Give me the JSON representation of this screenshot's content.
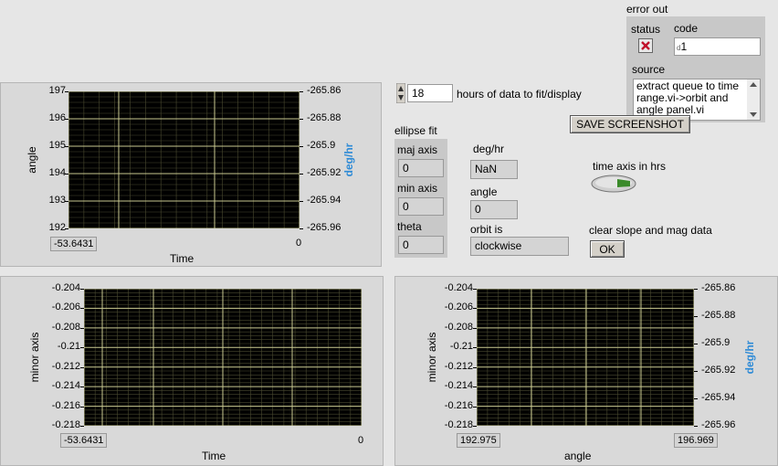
{
  "error_out": {
    "title": "error out",
    "status_label": "status",
    "code_label": "code",
    "code_value": "1",
    "code_prefix": "d",
    "source_label": "source",
    "source_text": "extract queue to time range.vi->orbit and angle panel.vi"
  },
  "hours": {
    "value": "18",
    "label": "hours of data to fit/display"
  },
  "save_button": "SAVE SCREENSHOT",
  "ellipse_fit": {
    "title": "ellipse fit",
    "maj_axis_label": "maj axis",
    "maj_axis_value": "0",
    "min_axis_label": "min axis",
    "min_axis_value": "0",
    "theta_label": "theta",
    "theta_value": "0"
  },
  "deg_hr": {
    "label": "deg/hr",
    "value": "NaN"
  },
  "angle_ind": {
    "label": "angle",
    "value": "0"
  },
  "orbit": {
    "label": "orbit is",
    "value": "clockwise"
  },
  "time_axis": {
    "label": "time axis in hrs"
  },
  "clear": {
    "label": "clear slope and mag data",
    "button": "OK"
  },
  "graph1": {
    "ylabel": "angle",
    "y2label": "deg/hr",
    "xlabel": "Time",
    "yticks": [
      "197",
      "196",
      "195",
      "194",
      "193",
      "192"
    ],
    "y2ticks": [
      "-265.86",
      "-265.88",
      "-265.9",
      "-265.92",
      "-265.94",
      "-265.96"
    ],
    "xmin": "-53.6431",
    "xmax": "0"
  },
  "graph2": {
    "ylabel": "minor axis",
    "xlabel": "Time",
    "yticks": [
      "-0.204",
      "-0.206",
      "-0.208",
      "-0.21",
      "-0.212",
      "-0.214",
      "-0.216",
      "-0.218"
    ],
    "xmin": "-53.6431",
    "xmax": "0"
  },
  "graph3": {
    "ylabel": "minor axis",
    "y2label": "deg/hr",
    "xlabel": "angle",
    "yticks": [
      "-0.204",
      "-0.206",
      "-0.208",
      "-0.21",
      "-0.212",
      "-0.214",
      "-0.216",
      "-0.218"
    ],
    "y2ticks": [
      "-265.86",
      "-265.88",
      "-265.9",
      "-265.92",
      "-265.94",
      "-265.96"
    ],
    "xmin": "192.975",
    "xmax": "196.969"
  },
  "colors": {
    "plot_bg": "#000000",
    "grid_major": "#c8c890",
    "grid_minor": "#4a4a30",
    "accent": "#2d8ad6"
  }
}
